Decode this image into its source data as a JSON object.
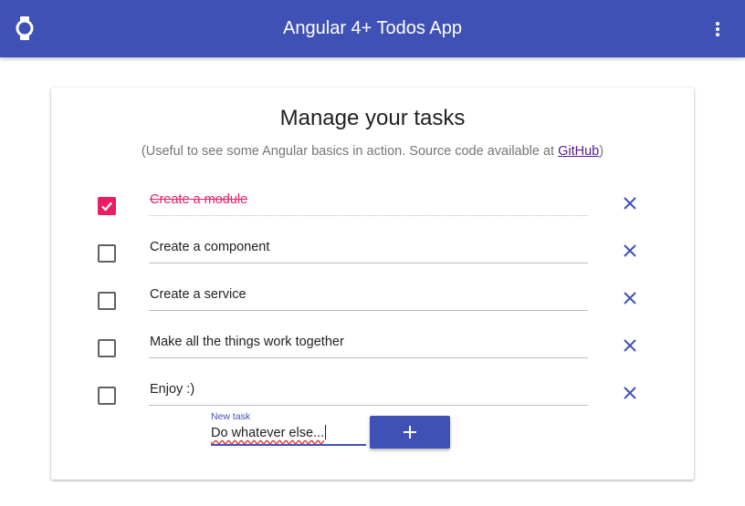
{
  "header": {
    "title": "Angular 4+ Todos App",
    "logo_icon": "watch-icon",
    "menu_icon": "more-vert-icon",
    "background_color": "#3f51b5"
  },
  "card": {
    "heading": "Manage your tasks",
    "subtitle_prefix": "(Useful to see some Angular basics in action. Source code available at ",
    "subtitle_link": "GitHub",
    "subtitle_suffix": ")"
  },
  "tasks": [
    {
      "text": "Create a module",
      "done": true
    },
    {
      "text": "Create a component",
      "done": false
    },
    {
      "text": "Create a service",
      "done": false
    },
    {
      "text": "Make all the things work together",
      "done": false
    },
    {
      "text": "Enjoy :)",
      "done": false
    }
  ],
  "new_task": {
    "label": "New task",
    "value": "Do whatever else..."
  },
  "add_button": {
    "icon": "plus-icon"
  },
  "colors": {
    "accent": "#e91e63",
    "primary": "#3f51b5"
  }
}
